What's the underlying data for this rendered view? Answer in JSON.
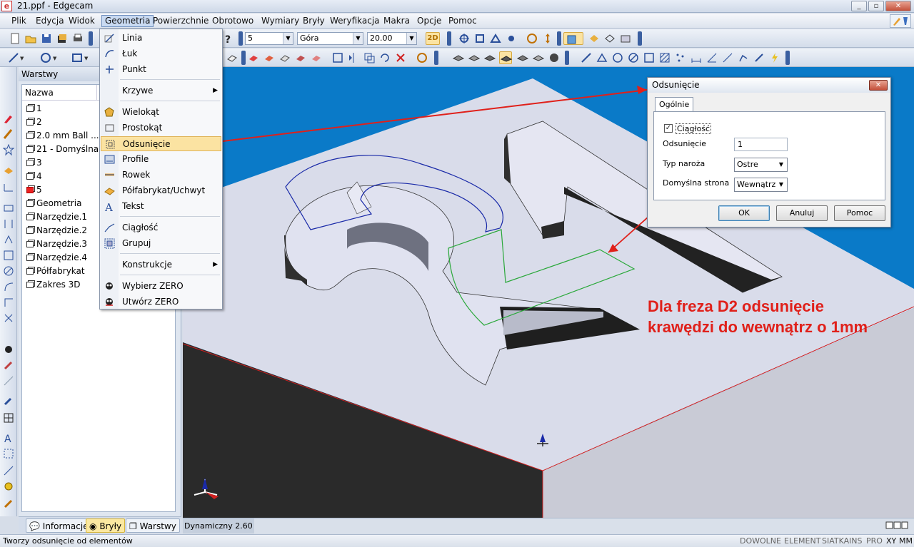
{
  "window": {
    "title": "21.ppf - Edgecam"
  },
  "menubar": {
    "items": [
      "Plik",
      "Edycja",
      "Widok",
      "Geometria",
      "Powierzchnie",
      "Obrotowo",
      "Wymiary",
      "Bryły",
      "Weryfikacja",
      "Makra",
      "Opcje",
      "Pomoc"
    ]
  },
  "toolbar": {
    "combo_value": "5",
    "view_value": "Góra",
    "depth_value": "20.00",
    "mode_2d": "2D"
  },
  "layers": {
    "title": "Warstwy",
    "col_name": "Nazwa",
    "items": [
      "1",
      "2",
      "2.0 mm Ball ...",
      "21 - Domyślna",
      "3",
      "4",
      "5",
      "Geometria",
      "Narzędzie.1",
      "Narzędzie.2",
      "Narzędzie.3",
      "Narzędzie.4",
      "Półfabrykat",
      "Zakres 3D"
    ]
  },
  "panel_tabs": [
    "Informacje",
    "Bryły",
    "Warstwy"
  ],
  "geometry_menu": {
    "items": [
      "Linia",
      "Łuk",
      "Punkt",
      "Krzywe",
      "Wielokąt",
      "Prostokąt",
      "Odsunięcie",
      "Profile",
      "Rowek",
      "Półfabrykat/Uchwyt",
      "Tekst",
      "Ciągłość",
      "Grupuj",
      "Konstrukcje",
      "Wybierz ZERO",
      "Utwórz ZERO"
    ]
  },
  "dialog": {
    "title": "Odsunięcie",
    "tab": "Ogólnie",
    "continuity_label": "Ciągłość",
    "continuity_checked": true,
    "offset_label": "Odsunięcie",
    "offset_value": "1",
    "corner_label": "Typ naroża",
    "corner_value": "Ostre",
    "side_label": "Domyślna strona",
    "side_value": "Wewnątrz",
    "ok": "OK",
    "cancel": "Anuluj",
    "help": "Pomoc"
  },
  "annotation": {
    "line1": "Dla freza D2 odsunięcie",
    "line2": "krawędzi do wewnątrz o 1mm"
  },
  "viewport": {
    "zoom_label": "Dynamiczny 2.60"
  },
  "status": {
    "text": "Tworzy odsunięcie od elementów",
    "indicators": [
      "DOWOLNE",
      "ELEMENT",
      "SIATKA",
      "INS",
      "PRO",
      "XY",
      "MM"
    ]
  },
  "colors": {
    "viewport_bg": "#0a7ac8",
    "annotation": "#e0201a",
    "menu_highlight": "#fbe3a2"
  }
}
